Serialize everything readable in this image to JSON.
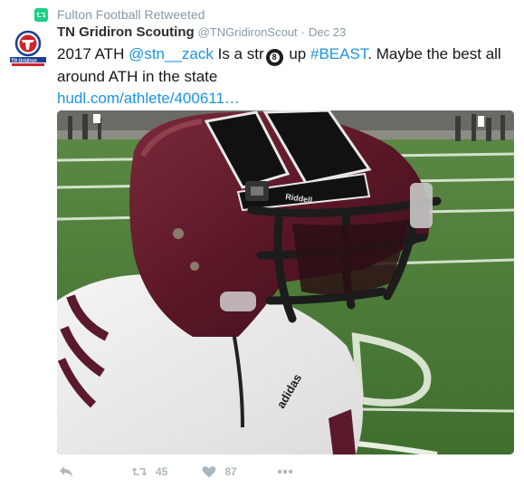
{
  "retweet_context": {
    "label": "Fulton Football Retweeted",
    "icon": "retweet-icon",
    "color": "#19cf86"
  },
  "tweet": {
    "fullname": "TN Gridiron Scouting",
    "username": "@TNGridironScout",
    "separator": "·",
    "timestamp": "Dec 23",
    "avatar": {
      "logo_text": "TN Gridiron Scouting",
      "colors": {
        "blue": "#1d3f8f",
        "red": "#d2232a"
      }
    },
    "text_parts": {
      "p1": "2017 ATH ",
      "mention": "@stn__zack",
      "p2": " Is a str",
      "emoji": "8",
      "p3": " up ",
      "hashtag": "#BEAST",
      "p4": ". Maybe the best all around ATH in the state",
      "link": "hudl.com/athlete/400611…"
    },
    "media": {
      "description": "football-player-helmet-photo"
    }
  },
  "actions": {
    "reply_icon": "reply-icon",
    "retweet_icon": "retweet-icon",
    "retweet_count": "45",
    "like_icon": "heart-icon",
    "like_count": "87",
    "more_icon": "more-icon"
  },
  "colors": {
    "link": "#1b95e0",
    "muted": "#8899a6",
    "action": "#aab8c2"
  }
}
